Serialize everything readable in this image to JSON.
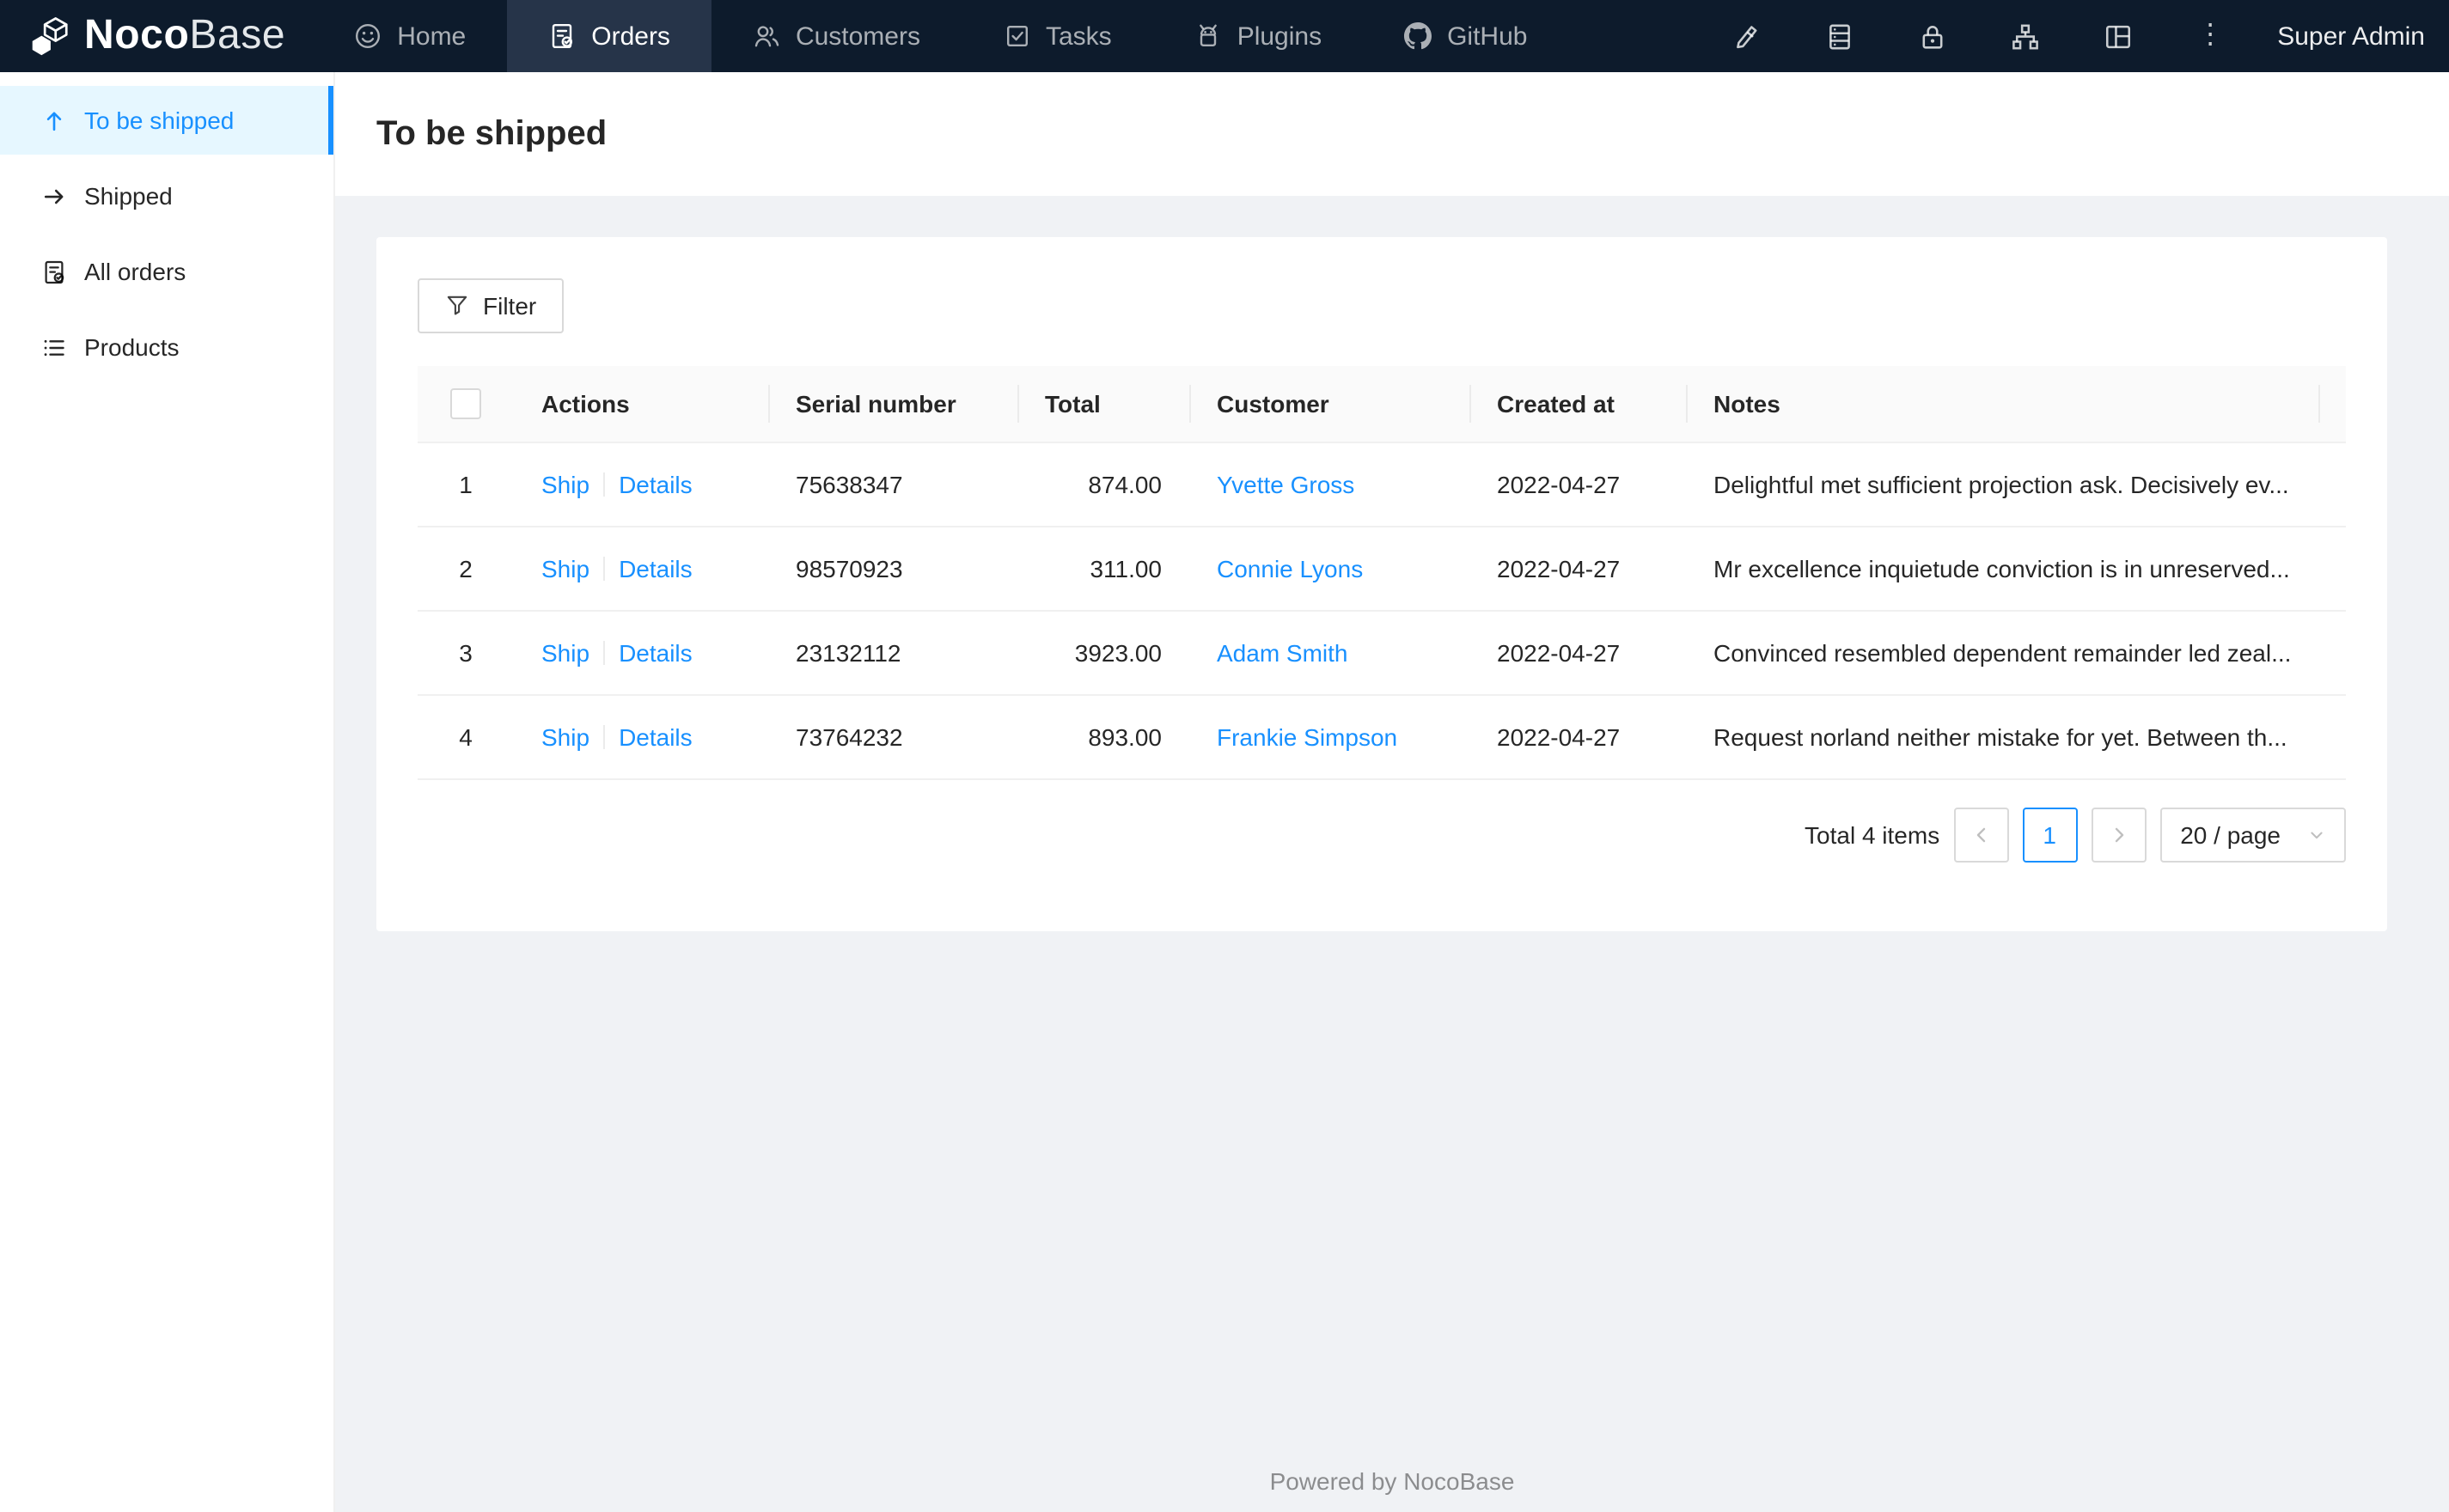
{
  "navbar": {
    "logo": {
      "bold": "Noco",
      "light": "Base"
    },
    "items": [
      {
        "label": "Home",
        "icon": "smile-icon",
        "active": false
      },
      {
        "label": "Orders",
        "icon": "orders-icon",
        "active": true
      },
      {
        "label": "Customers",
        "icon": "team-icon",
        "active": false
      },
      {
        "label": "Tasks",
        "icon": "check-square-icon",
        "active": false
      },
      {
        "label": "Plugins",
        "icon": "robot-icon",
        "active": false
      },
      {
        "label": "GitHub",
        "icon": "github-icon",
        "active": false
      }
    ],
    "right_icons": [
      "highlight-icon",
      "database-icon",
      "lock-icon",
      "apartment-icon",
      "layout-icon",
      "more-icon"
    ],
    "user": "Super Admin"
  },
  "sidebar": {
    "items": [
      {
        "label": "To be shipped",
        "icon": "arrow-up-icon",
        "active": true
      },
      {
        "label": "Shipped",
        "icon": "arrow-right-icon",
        "active": false
      },
      {
        "label": "All orders",
        "icon": "orders-icon",
        "active": false
      },
      {
        "label": "Products",
        "icon": "unordered-list-icon",
        "active": false
      }
    ]
  },
  "page": {
    "title": "To be shipped"
  },
  "toolbar": {
    "filter_label": "Filter"
  },
  "table": {
    "columns": {
      "actions": "Actions",
      "serial": "Serial number",
      "total": "Total",
      "customer": "Customer",
      "created_at": "Created at",
      "notes": "Notes"
    },
    "action_labels": {
      "ship": "Ship",
      "details": "Details"
    },
    "rows": [
      {
        "index": "1",
        "serial": "75638347",
        "total": "874.00",
        "customer": "Yvette Gross",
        "created_at": "2022-04-27",
        "notes": "Delightful met sufficient projection ask. Decisively ev..."
      },
      {
        "index": "2",
        "serial": "98570923",
        "total": "311.00",
        "customer": "Connie Lyons",
        "created_at": "2022-04-27",
        "notes": "Mr excellence inquietude conviction is in unreserved..."
      },
      {
        "index": "3",
        "serial": "23132112",
        "total": "3923.00",
        "customer": "Adam Smith",
        "created_at": "2022-04-27",
        "notes": "Convinced resembled dependent remainder led zeal..."
      },
      {
        "index": "4",
        "serial": "73764232",
        "total": "893.00",
        "customer": "Frankie Simpson",
        "created_at": "2022-04-27",
        "notes": "Request norland neither mistake for yet. Between th..."
      }
    ]
  },
  "pagination": {
    "total_text": "Total 4 items",
    "current_page": "1",
    "page_size": "20 / page"
  },
  "footer": {
    "text": "Powered by NocoBase"
  },
  "colors": {
    "accent": "#1890ff",
    "navbar_bg": "#0d1b2c",
    "navbar_active_bg": "#263449",
    "sidebar_selected_bg": "#e6f7ff",
    "content_bg": "#f0f2f5",
    "table_header_bg": "#fafafa",
    "border": "#f0f0f0"
  }
}
